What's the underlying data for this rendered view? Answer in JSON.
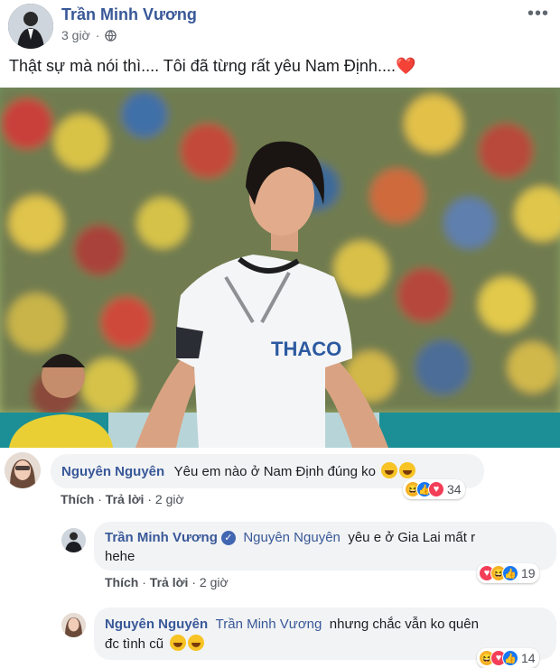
{
  "post": {
    "author": "Trần Minh Vương",
    "time": "3 giờ",
    "audience_icon": "globe-icon",
    "text": "Thật sự mà nói thì.... Tôi đã từng rất yêu Nam Định....",
    "text_emoji": "❤️"
  },
  "photo": {
    "jersey_text": "THACO"
  },
  "comments": [
    {
      "author": "Nguyên Nguyên",
      "text": "Yêu em nào ở Nam Định đúng ko",
      "reactions": [
        "haha",
        "like",
        "love"
      ],
      "count": "34",
      "like_label": "Thích",
      "reply_label": "Trả lời",
      "time": "2 giờ"
    },
    {
      "author": "Trần Minh Vương",
      "mention": "Nguyên Nguyên",
      "text_line1": "yêu e ở Gia Lai mất r",
      "text_line2": "hehe",
      "reactions": [
        "love",
        "haha",
        "like"
      ],
      "count": "19",
      "like_label": "Thích",
      "reply_label": "Trả lời",
      "time": "2 giờ"
    },
    {
      "author": "Nguyên Nguyên",
      "mention": "Trần Minh Vương",
      "text_line1": "nhưng chắc vẫn ko quên",
      "text_line2": "đc tình cũ",
      "reactions": [
        "haha",
        "love",
        "like"
      ],
      "count": "14"
    }
  ],
  "colors": {
    "link": "#385898",
    "bubble": "#f2f3f5",
    "secondary": "#616770"
  }
}
